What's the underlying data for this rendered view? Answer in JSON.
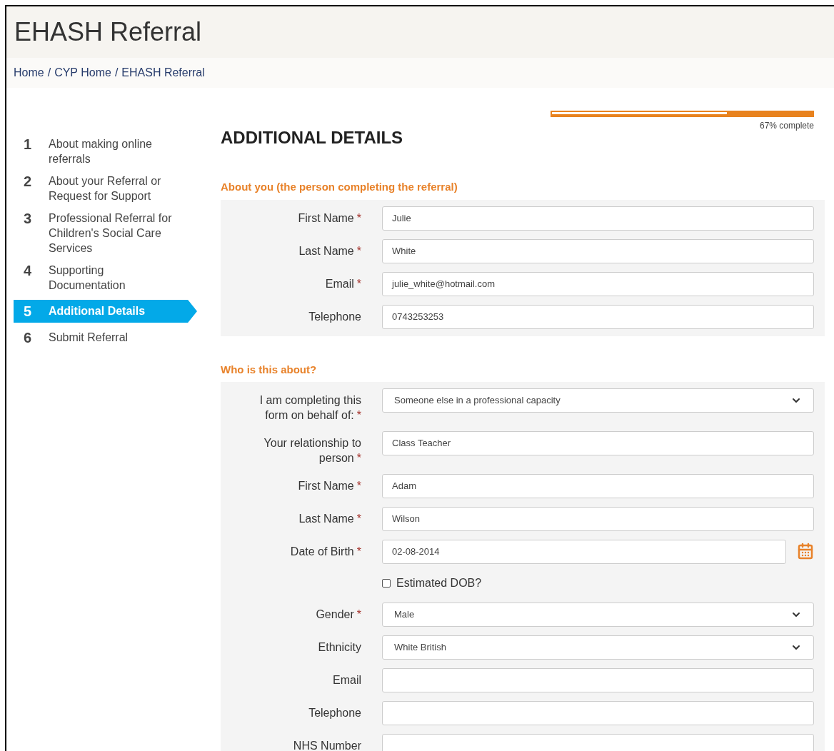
{
  "header": {
    "title": "EHASH Referral"
  },
  "breadcrumb": [
    {
      "label": "Home"
    },
    {
      "separator": "/",
      "label": "CYP Home"
    },
    {
      "separator": "/",
      "label": "EHASH Referral"
    }
  ],
  "steps": [
    {
      "number": "1",
      "label": "About making online referrals",
      "selected": false
    },
    {
      "number": "2",
      "label": "About your Referral or Request for Support",
      "selected": false
    },
    {
      "number": "3",
      "label": "Professional Referral for Children's Social Care Services",
      "selected": false
    },
    {
      "number": "4",
      "label": "Supporting Documentation",
      "selected": false
    },
    {
      "number": "5",
      "label": "Additional Details",
      "selected": true
    },
    {
      "number": "6",
      "label": "Submit Referral",
      "selected": false
    }
  ],
  "progress": {
    "level": 0.67,
    "reading": "67% complete"
  },
  "page_title": "ADDITIONAL DETAILS",
  "sections": [
    {
      "heading": "About you (the person completing the referral)",
      "fields": [
        {
          "kind": "text",
          "label": "First Name",
          "required_mark": "*",
          "value": "Julie"
        },
        {
          "kind": "text",
          "label": "Last Name",
          "required_mark": "*",
          "value": "White"
        },
        {
          "kind": "text",
          "label": "Email",
          "required_mark": "*",
          "value": "julie_white@hotmail.com"
        },
        {
          "kind": "text",
          "label": "Telephone",
          "value": "0743253253"
        }
      ]
    },
    {
      "heading": "Who is this about?",
      "fields": [
        {
          "kind": "select",
          "label": "I am completing this form on behalf of:",
          "required_mark": "*",
          "value": "Someone else in a professional capacity"
        },
        {
          "kind": "text",
          "label": "Your relationship to person",
          "required_mark": "*",
          "value": "Class Teacher"
        },
        {
          "kind": "text",
          "label": "First Name",
          "required_mark": "*",
          "value": "Adam"
        },
        {
          "kind": "text",
          "label": "Last Name",
          "required_mark": "*",
          "value": "Wilson"
        },
        {
          "kind": "date",
          "label": "Date of Birth",
          "required_mark": "*",
          "value": "02-08-2014"
        },
        {
          "kind": "checkbox",
          "label": "Estimated DOB?",
          "checked": false
        },
        {
          "kind": "select",
          "label": "Gender",
          "required_mark": "*",
          "value": "Male"
        },
        {
          "kind": "select",
          "label": "Ethnicity",
          "value": "White British"
        },
        {
          "kind": "text",
          "label": "Email"
        },
        {
          "kind": "text",
          "label": "Telephone"
        },
        {
          "kind": "text",
          "label": "NHS Number"
        }
      ]
    }
  ]
}
